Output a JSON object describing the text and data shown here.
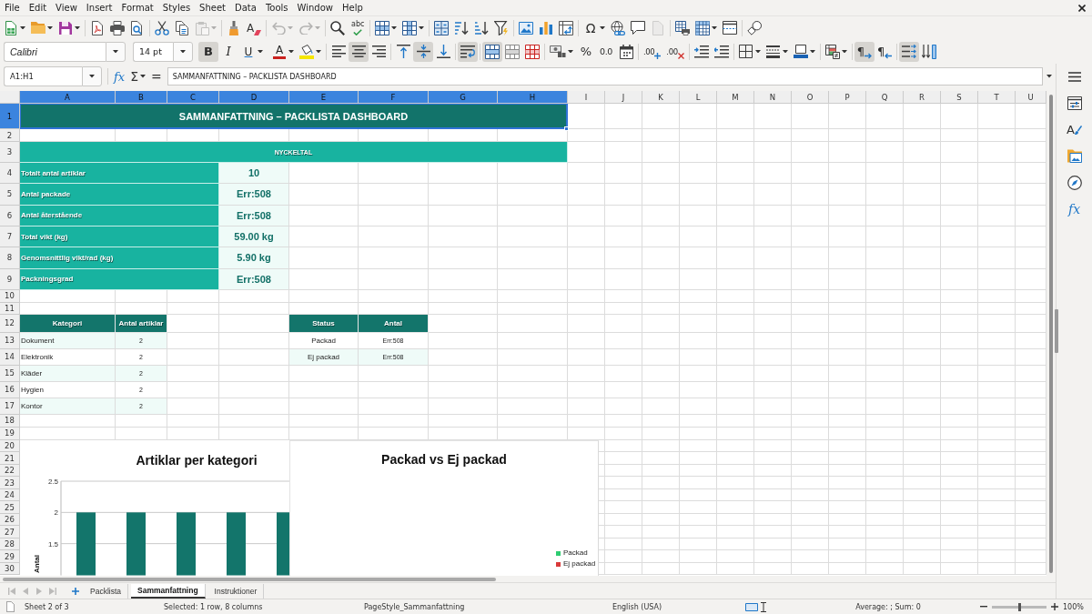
{
  "menu_bar": [
    "File",
    "Edit",
    "View",
    "Insert",
    "Format",
    "Styles",
    "Sheet",
    "Data",
    "Tools",
    "Window",
    "Help"
  ],
  "standard_toolbar": [
    {
      "disabled": false
    },
    {
      "disabled": false
    },
    {
      "disabled": false
    },
    {
      "disabled": false
    },
    {
      "disabled": false
    },
    {
      "disabled": false
    },
    {
      "disabled": false
    },
    {
      "disabled": false
    },
    {
      "disabled": true
    },
    {
      "disabled": false
    },
    {
      "disabled": false,
      "glyph": "A"
    },
    {
      "disabled": true
    },
    {
      "disabled": true
    },
    {
      "disabled": false
    },
    {
      "disabled": false,
      "glyph": "abc"
    },
    {
      "disabled": false
    },
    {
      "disabled": false
    },
    {
      "disabled": false
    },
    {
      "disabled": false
    },
    {
      "disabled": false
    },
    {
      "disabled": false
    },
    {
      "disabled": false
    },
    {
      "disabled": false
    },
    {
      "disabled": false
    },
    {
      "disabled": false,
      "glyph": "Ω"
    },
    {
      "disabled": false
    },
    {
      "disabled": false
    },
    {
      "disabled": true
    },
    {
      "disabled": false
    },
    {
      "disabled": false
    },
    {
      "disabled": false
    },
    {
      "disabled": false
    }
  ],
  "formatting_toolbar": {
    "font_name": "Calibri",
    "font_size": "14 pt",
    "buttons": [
      {
        "pressed": true,
        "glyph": "B"
      },
      {
        "pressed": false,
        "glyph": "I"
      },
      {
        "pressed": false,
        "glyph": "U"
      },
      {
        "pressed": false,
        "glyph": "A"
      },
      {
        "pressed": false
      },
      {
        "pressed": false
      },
      {
        "pressed": true
      },
      {
        "pressed": false
      },
      {
        "pressed": false
      },
      {
        "pressed": true
      },
      {
        "pressed": false
      },
      {
        "pressed": true
      },
      {
        "pressed": true
      },
      {
        "pressed": false
      },
      {
        "pressed": false
      },
      {
        "pressed": false
      },
      {
        "pressed": false,
        "glyph": "%"
      },
      {
        "pressed": false,
        "glyph": "0.0"
      },
      {
        "pressed": false
      },
      {
        "pressed": false,
        "glyph": ".00"
      },
      {
        "pressed": false,
        "glyph": ".00"
      },
      {
        "pressed": false
      },
      {
        "pressed": false
      },
      {
        "pressed": false
      },
      {
        "pressed": false
      },
      {
        "pressed": false
      },
      {
        "pressed": false
      },
      {
        "pressed": true,
        "glyph": "¶"
      },
      {
        "pressed": false,
        "glyph": "¶"
      },
      {
        "pressed": true
      },
      {
        "pressed": false
      }
    ]
  },
  "formula_bar": {
    "name_box": "A1:H1",
    "function_wizard": "fx",
    "sum": "Σ",
    "equals": "=",
    "content": "SAMMANFATTNING – PACKLISTA DASHBOARD"
  },
  "sheet": {
    "columns": [
      {
        "label": "A",
        "selected": true
      },
      {
        "label": "B",
        "selected": true
      },
      {
        "label": "C",
        "selected": true
      },
      {
        "label": "D",
        "selected": true
      },
      {
        "label": "E",
        "selected": true
      },
      {
        "label": "F",
        "selected": true
      },
      {
        "label": "G",
        "selected": true
      },
      {
        "label": "H",
        "selected": true
      },
      {
        "label": "I",
        "selected": false
      },
      {
        "label": "J",
        "selected": false
      },
      {
        "label": "K",
        "selected": false
      },
      {
        "label": "L",
        "selected": false
      },
      {
        "label": "M",
        "selected": false
      },
      {
        "label": "N",
        "selected": false
      },
      {
        "label": "O",
        "selected": false
      },
      {
        "label": "P",
        "selected": false
      },
      {
        "label": "Q",
        "selected": false
      },
      {
        "label": "R",
        "selected": false
      },
      {
        "label": "S",
        "selected": false
      },
      {
        "label": "T",
        "selected": false
      },
      {
        "label": "U",
        "selected": false
      }
    ],
    "rows": [
      {
        "label": "1",
        "selected": true
      },
      {
        "label": "2",
        "selected": false
      },
      {
        "label": "3",
        "selected": false
      },
      {
        "label": "4",
        "selected": false
      },
      {
        "label": "5",
        "selected": false
      },
      {
        "label": "6",
        "selected": false
      },
      {
        "label": "7",
        "selected": false
      },
      {
        "label": "8",
        "selected": false
      },
      {
        "label": "9",
        "selected": false
      },
      {
        "label": "10",
        "selected": false
      },
      {
        "label": "11",
        "selected": false
      },
      {
        "label": "12",
        "selected": false
      },
      {
        "label": "13",
        "selected": false
      },
      {
        "label": "14",
        "selected": false
      },
      {
        "label": "15",
        "selected": false
      },
      {
        "label": "16",
        "selected": false
      },
      {
        "label": "17",
        "selected": false
      },
      {
        "label": "18",
        "selected": false
      },
      {
        "label": "19",
        "selected": false
      },
      {
        "label": "20",
        "selected": false
      },
      {
        "label": "21",
        "selected": false
      },
      {
        "label": "22",
        "selected": false
      },
      {
        "label": "23",
        "selected": false
      },
      {
        "label": "24",
        "selected": false
      },
      {
        "label": "25",
        "selected": false
      },
      {
        "label": "26",
        "selected": false
      },
      {
        "label": "27",
        "selected": false
      },
      {
        "label": "28",
        "selected": false
      },
      {
        "label": "29",
        "selected": false
      },
      {
        "label": "30",
        "selected": false
      }
    ],
    "title": "SAMMANFATTNING – PACKLISTA DASHBOARD",
    "key_figures": {
      "heading": "NYCKELTAL",
      "items": [
        {
          "label": "Totalt antal artiklar",
          "value": "10"
        },
        {
          "label": "Antal packade",
          "value": "Err:508"
        },
        {
          "label": "Antal återstående",
          "value": "Err:508"
        },
        {
          "label": "Total vikt (kg)",
          "value": "59.00 kg"
        },
        {
          "label": "Genomsnittlig vikt/rad (kg)",
          "value": "5.90 kg"
        },
        {
          "label": "Packningsgrad",
          "value": "Err:508"
        }
      ]
    },
    "category_table": {
      "columns": [
        "Kategori",
        "Antal artiklar"
      ],
      "rows": [
        {
          "cells": [
            "Dokument",
            "2"
          ],
          "shaded": true
        },
        {
          "cells": [
            "Elektronik",
            "2"
          ],
          "shaded": false
        },
        {
          "cells": [
            "Kläder",
            "2"
          ],
          "shaded": true
        },
        {
          "cells": [
            "Hygien",
            "2"
          ],
          "shaded": false
        },
        {
          "cells": [
            "Kontor",
            "2"
          ],
          "shaded": true
        }
      ]
    },
    "status_table": {
      "columns": [
        "Status",
        "Antal"
      ],
      "rows": [
        {
          "cells": [
            "Packad",
            "Err:508"
          ],
          "shaded": false
        },
        {
          "cells": [
            "Ej packad",
            "Err:508"
          ],
          "shaded": true
        }
      ]
    },
    "category_chart": {
      "chart_data": {
        "type": "bar",
        "title": "Artiklar per kategori",
        "ylabel": "Antal",
        "series": [
          {
            "color": "#13756b",
            "values": [
              2,
              2,
              2,
              2,
              2
            ]
          }
        ],
        "ylim": [
          1,
          2.5
        ],
        "yticks": [
          1.5,
          2,
          2.5
        ]
      }
    },
    "status_chart": {
      "title": "Packad vs Ej packad",
      "legend": [
        {
          "label": "Packad",
          "color": "#2ecc71"
        },
        {
          "label": "Ej packad",
          "color": "#d93a3a"
        }
      ]
    }
  },
  "sheet_navigation": [
    {
      "disabled": true
    },
    {
      "disabled": true
    },
    {
      "disabled": true
    },
    {
      "disabled": true
    }
  ],
  "sheet_tabs": [
    {
      "label": "Packlista",
      "selected": false
    },
    {
      "label": "Sammanfattning",
      "selected": true
    },
    {
      "label": "Instruktioner",
      "selected": false
    }
  ],
  "sidebar": {
    "styles_glyph": "A",
    "functions_glyph": "fx"
  },
  "status_bar": {
    "sheet": "Sheet 2 of 3",
    "selection": "Selected: 1 row, 8 columns",
    "page_style": "PageStyle_Sammanfattning",
    "language": "English (USA)",
    "summary": "Average: ; Sum: 0",
    "zoom": {
      "level": 0.5,
      "reading": "100%"
    }
  }
}
